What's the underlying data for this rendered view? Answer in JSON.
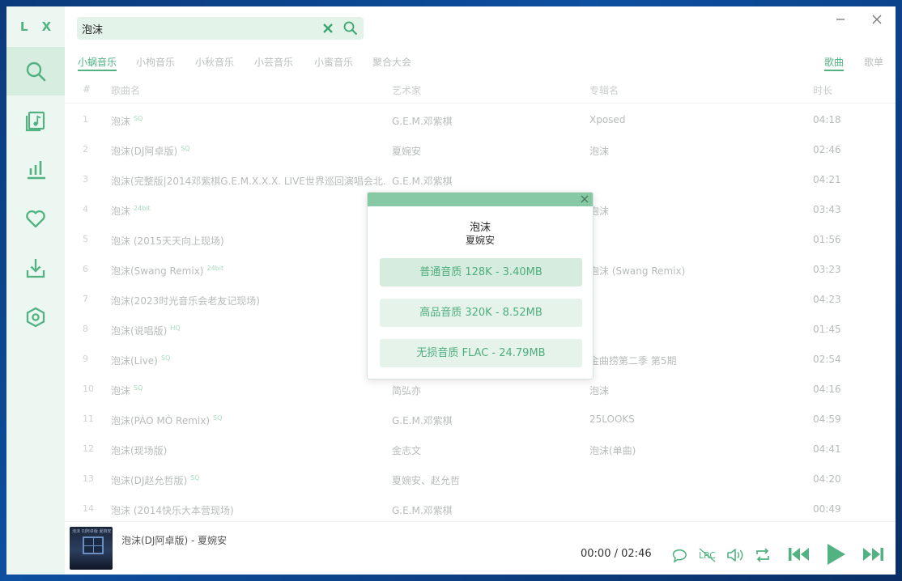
{
  "app": {
    "logo": "L X"
  },
  "search": {
    "value": "泡沫"
  },
  "sources": [
    "小蜗音乐",
    "小枸音乐",
    "小秋音乐",
    "小芸音乐",
    "小蜜音乐",
    "聚合大会"
  ],
  "view_tabs": [
    "歌曲",
    "歌单"
  ],
  "table": {
    "headers": {
      "num": "#",
      "name": "歌曲名",
      "artist": "艺术家",
      "album": "专辑名",
      "duration": "时长"
    },
    "rows": [
      {
        "num": "1",
        "name": "泡沫",
        "badge": "SQ",
        "artist": "G.E.M.邓紫棋",
        "album": "Xposed",
        "duration": "04:18"
      },
      {
        "num": "2",
        "name": "泡沫(DJ阿卓版)",
        "badge": "SQ",
        "artist": "夏婉安",
        "album": "泡沫",
        "duration": "02:46"
      },
      {
        "num": "3",
        "name": "泡沫(完整版|2014邓紫棋G.E.M.X.X.X. LIVE世界巡回演唱会北...",
        "badge": "",
        "artist": "G.E.M.邓紫棋",
        "album": "",
        "duration": "04:21"
      },
      {
        "num": "4",
        "name": "泡沫",
        "badge": "24bit",
        "artist": "",
        "album": "泡沫",
        "duration": "03:43"
      },
      {
        "num": "5",
        "name": "泡沫 (2015天天向上现场)",
        "badge": "",
        "artist": "",
        "album": "",
        "duration": "01:56"
      },
      {
        "num": "6",
        "name": "泡沫(Swang Remix)",
        "badge": "24bit",
        "artist": "",
        "album": "泡沫 (Swang Remix)",
        "duration": "03:23"
      },
      {
        "num": "7",
        "name": "泡沫(2023时光音乐会老友记现场)",
        "badge": "",
        "artist": "",
        "album": "",
        "duration": "04:23"
      },
      {
        "num": "8",
        "name": "泡沫(说唱版)",
        "badge": "HQ",
        "artist": "",
        "album": "",
        "duration": "01:45"
      },
      {
        "num": "9",
        "name": "泡沫(Live)",
        "badge": "SQ",
        "artist": "",
        "album": "金曲捞第二季 第5期",
        "duration": "02:54"
      },
      {
        "num": "10",
        "name": "泡沫",
        "badge": "SQ",
        "artist": "简弘亦",
        "album": "泡沫",
        "duration": "04:16"
      },
      {
        "num": "11",
        "name": "泡沫(PÀO MÒ Remix)",
        "badge": "SQ",
        "artist": "G.E.M.邓紫棋",
        "album": "25LOOKS",
        "duration": "04:59"
      },
      {
        "num": "12",
        "name": "泡沫(现场版)",
        "badge": "",
        "artist": "金志文",
        "album": "泡沫(单曲)",
        "duration": "04:41"
      },
      {
        "num": "13",
        "name": "泡沫(DJ赵允哲版)",
        "badge": "SQ",
        "artist": "夏婉安、赵允哲",
        "album": "",
        "duration": "04:20"
      },
      {
        "num": "14",
        "name": "泡沫 (2014快乐大本营现场)",
        "badge": "",
        "artist": "G.E.M.邓紫棋",
        "album": "",
        "duration": "00:49"
      }
    ]
  },
  "player": {
    "now_playing": "泡沫(DJ阿卓版) - 夏婉安",
    "current_time": "00:00",
    "separator": "/",
    "total_time": "02:46",
    "cover_text": "泡沫 DJ阿卓版 夏婉安"
  },
  "modal": {
    "song": "泡沫",
    "artist": "夏婉安",
    "options": [
      "普通音质 128K - 3.40MB",
      "高品音质 320K - 8.52MB",
      "无损音质 FLAC - 24.79MB"
    ]
  },
  "colors": {
    "accent": "#52b281",
    "sidebar": "#edf7f1",
    "modal_bar": "#86c9a4"
  }
}
